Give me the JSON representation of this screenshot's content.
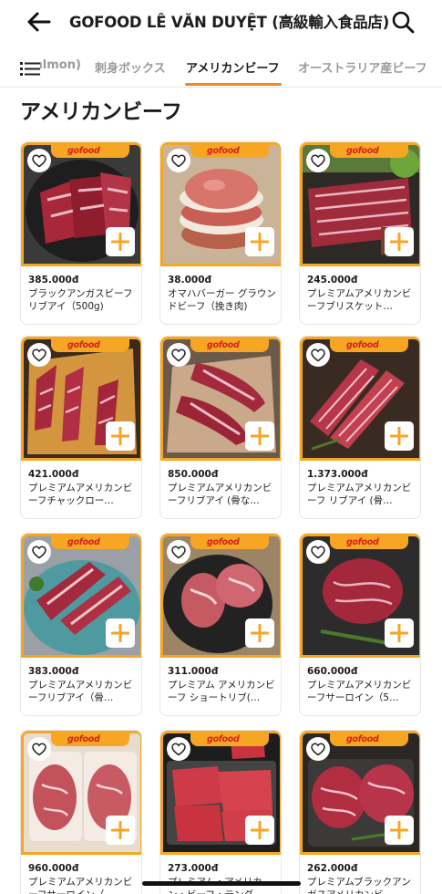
{
  "header": {
    "title": "GOFOOD LÊ VĂN DUYỆT (高級輸入食品店)",
    "back_icon": "arrow-left-icon",
    "search_icon": "search-icon"
  },
  "tabs": {
    "menu_icon": "list-menu-icon",
    "items": [
      {
        "label": "almon)"
      },
      {
        "label": "刺身ボックス"
      },
      {
        "label": "アメリカンビーフ"
      },
      {
        "label": "オーストラリア産ビーフ"
      }
    ],
    "active_index": 2,
    "accent_color": "#ee8a1b"
  },
  "section": {
    "title": "アメリカンビーフ"
  },
  "brand_label": "gofood",
  "products": [
    {
      "price": "385.000đ",
      "name": "ブラックアンガスビーフリブアイ（500g)",
      "photo": "short-ribs-dark-plate"
    },
    {
      "price": "38.000đ",
      "name": "オマハバーガー グラウンドビーフ（挽き肉)",
      "photo": "burger-patties"
    },
    {
      "price": "245.000đ",
      "name": "プレミアムアメリカンビーフブリスケット…",
      "photo": "sliced-brisket"
    },
    {
      "price": "421.000đ",
      "name": "プレミアムアメリカンビーフチャックロー…",
      "photo": "chuck-on-board"
    },
    {
      "price": "850.000đ",
      "name": "プレミアムアメリカンビーフリブアイ (骨な…",
      "photo": "ribeye-on-paper"
    },
    {
      "price": "1.373.000đ",
      "name": "プレミアムアメリカンビーフ リブアイ (骨…",
      "photo": "marbled-ribs"
    },
    {
      "price": "383.000đ",
      "name": "プレミアムアメリカンビーフリブアイ（骨…",
      "photo": "ribs-blue-plate"
    },
    {
      "price": "311.000đ",
      "name": "プレミアム アメリカンビーフ ショートリブ(…",
      "photo": "short-rib-rounds"
    },
    {
      "price": "660.000đ",
      "name": "プレミアムアメリカンビーフサーロイン（5…",
      "photo": "sirloin-steak"
    },
    {
      "price": "960.000đ",
      "name": "プレミアムアメリカンビーフサーロイン（…",
      "photo": "sirloin-pack"
    },
    {
      "price": "273.000đ",
      "name": "プレミアム・アメリカン・ビーフ・テンダ…",
      "photo": "tenderloin-slices"
    },
    {
      "price": "262.000đ",
      "name": "プレミアムブラックアンガスアメリカンビ…",
      "photo": "angus-steaks-tray"
    }
  ],
  "colors": {
    "card_frame": "#f6a623",
    "add_icon": "#f6a623",
    "brand_text": "#d4211e"
  }
}
